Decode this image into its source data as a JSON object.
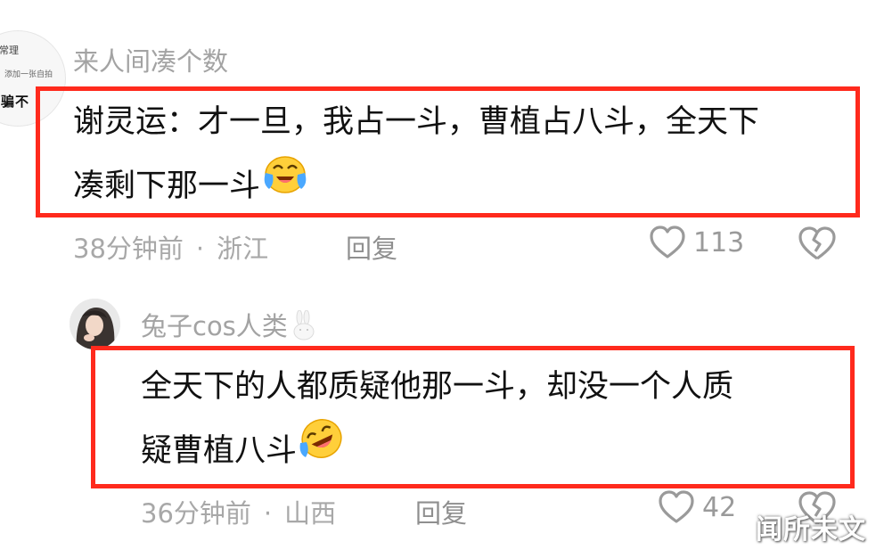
{
  "comments": [
    {
      "username": "来人间凑个数",
      "text_line1": "谢灵运：才一旦，我占一斗，曹植占八斗，全天下",
      "text_line2": "凑剩下那一斗",
      "time": "38分钟前",
      "location": "浙江",
      "reply_label": "回复",
      "likes": "113",
      "avatar_text": [
        "常理",
        "添加一张自拍",
        "骗不"
      ],
      "emoji": "crying-laughing-emoji"
    },
    {
      "username": "兔子cos人类",
      "text_line1": "全天下的人都质疑他那一斗，却没一个人质",
      "text_line2": "疑曹植八斗",
      "time": "36分钟前",
      "location": "山西",
      "reply_label": "回复",
      "likes": "42",
      "emoji": "rolling-laughing-emoji"
    }
  ],
  "separator": "·",
  "watermark": "闻所未文",
  "colors": {
    "highlight": "#ff2a1d",
    "meta": "#a8a8a8",
    "text": "#111111"
  }
}
